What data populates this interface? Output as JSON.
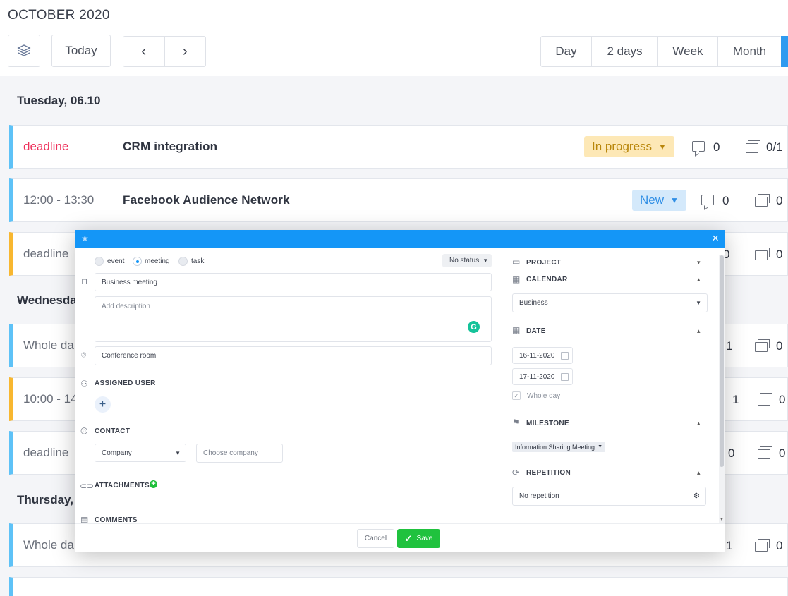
{
  "header": {
    "month_title": "OCTOBER 2020",
    "today_label": "Today",
    "prev_icon": "‹",
    "next_icon": "›",
    "views": [
      "Day",
      "2 days",
      "Week",
      "Month"
    ]
  },
  "days": [
    {
      "label": "Tuesday, 06.10"
    },
    {
      "label": "Wednesday"
    },
    {
      "label": "Thursday,"
    }
  ],
  "events": [
    {
      "time": "deadline",
      "title": "CRM integration",
      "status": "In progress",
      "comments": "0",
      "subtasks": "0/1"
    },
    {
      "time": "12:00 - 13:30",
      "title": "Facebook Audience Network",
      "status": "New",
      "comments": "0",
      "subtasks": "0"
    },
    {
      "time": "deadline",
      "title": "",
      "comments": "0",
      "subtasks": "0"
    },
    {
      "time": "Whole da",
      "title": "",
      "comments": "1",
      "subtasks": "0"
    },
    {
      "time": "10:00 - 14:",
      "title": "",
      "comments": "1",
      "subtasks": "0"
    },
    {
      "time": "deadline",
      "title": "",
      "comments": "0",
      "subtasks": "0"
    },
    {
      "time": "Whole da",
      "title": "",
      "comments": "1",
      "subtasks": "0"
    }
  ],
  "modal": {
    "types": [
      "event",
      "meeting",
      "task"
    ],
    "selected_type": "meeting",
    "status_select": "No status",
    "title_value": "Business meeting",
    "description_placeholder": "Add description",
    "location_value": "Conference room",
    "assigned_user_label": "ASSIGNED USER",
    "contact_label": "CONTACT",
    "contact_type": "Company",
    "contact_placeholder": "Choose company",
    "attachments_label": "ATTACHMENTS",
    "comments_label": "COMMENTS",
    "project_label": "PROJECT",
    "calendar_label": "CALENDAR",
    "calendar_value": "Business",
    "date_label": "DATE",
    "date_start": "16-11-2020",
    "date_end": "17-11-2020",
    "whole_day_label": "Whole day",
    "milestone_label": "MILESTONE",
    "milestone_value": "Information Sharing Meeting",
    "repetition_label": "REPETITION",
    "repetition_value": "No repetition",
    "cancel_label": "Cancel",
    "save_label": "Save"
  },
  "colors": {
    "accent": "#1496f7",
    "save": "#20c23e",
    "deadline": "#ee2f5a",
    "row_blue": "#5ec2f7",
    "row_orange": "#f8b730",
    "status_progress_bg": "#fde8b6",
    "status_new_bg": "#d4e9fb"
  }
}
